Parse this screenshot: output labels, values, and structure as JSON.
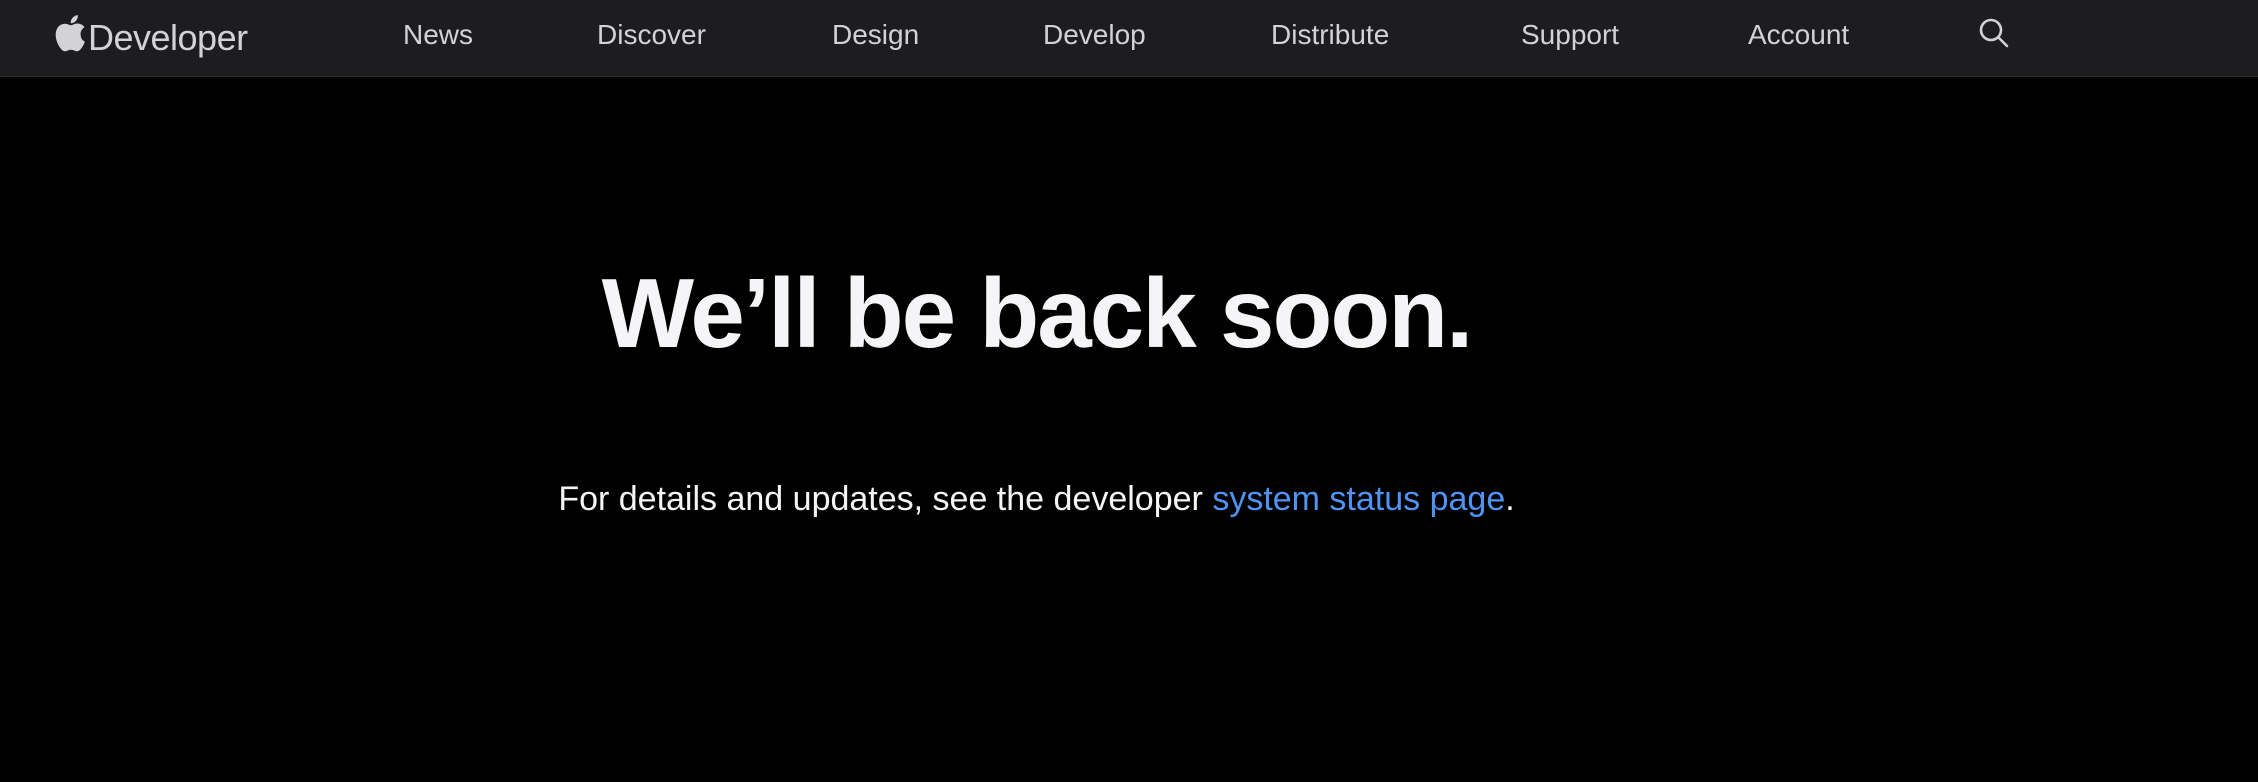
{
  "nav": {
    "brand_icon": "apple-logo",
    "brand_text": "Developer",
    "items": [
      {
        "label": "News"
      },
      {
        "label": "Discover"
      },
      {
        "label": "Design"
      },
      {
        "label": "Develop"
      },
      {
        "label": "Distribute"
      },
      {
        "label": "Support"
      },
      {
        "label": "Account"
      }
    ],
    "search_icon": "search-icon"
  },
  "main": {
    "title": "We’ll be back soon.",
    "message_prefix": "For details and updates, see the developer ",
    "link_text": "system status page",
    "message_suffix": "."
  },
  "colors": {
    "nav_background": "#1d1d1f",
    "page_background": "#000000",
    "text": "#f5f5f7",
    "nav_text": "#d2d2d7",
    "link": "#4f93f4"
  }
}
